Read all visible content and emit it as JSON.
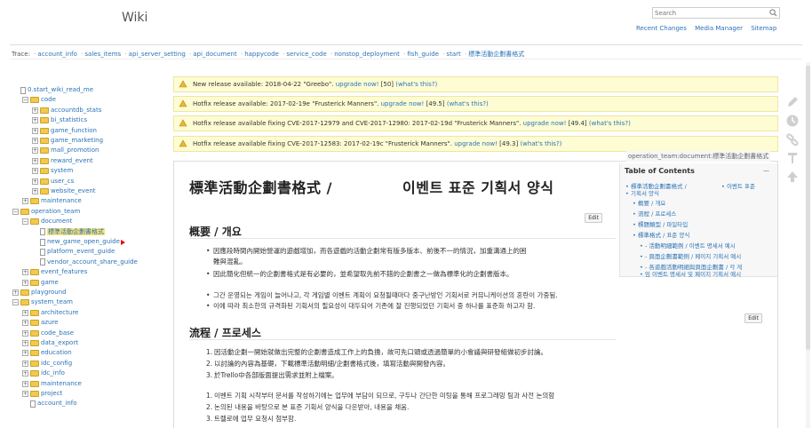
{
  "header": {
    "site_title": "Wiki",
    "search_placeholder": "Search",
    "links": [
      "Recent Changes",
      "Media Manager",
      "Sitemap"
    ]
  },
  "breadcrumbs": {
    "label": "Trace:",
    "items": [
      "account_info",
      "sales_items",
      "api_server_setting",
      "api_document",
      "happycode",
      "service_code",
      "nonstop_deployment",
      "fish_guide",
      "start"
    ],
    "current": "標準活動企劃書格式"
  },
  "sidebar": {
    "tree": [
      {
        "label": "0.start_wiki_read_me",
        "kind": "page",
        "toggle": "",
        "active": false
      },
      {
        "label": "code",
        "kind": "folder",
        "toggle": "-",
        "active": false
      },
      {
        "label": "accountdb_stats",
        "kind": "folder",
        "toggle": "+",
        "active": false
      },
      {
        "label": "bi_statistics",
        "kind": "folder",
        "toggle": "+",
        "active": false
      },
      {
        "label": "game_function",
        "kind": "folder",
        "toggle": "+",
        "active": false
      },
      {
        "label": "game_marketing",
        "kind": "folder",
        "toggle": "+",
        "active": false
      },
      {
        "label": "mall_promotion",
        "kind": "folder",
        "toggle": "+",
        "active": false
      },
      {
        "label": "reward_event",
        "kind": "folder",
        "toggle": "+",
        "active": false
      },
      {
        "label": "system",
        "kind": "folder",
        "toggle": "+",
        "active": false
      },
      {
        "label": "user_cs",
        "kind": "folder",
        "toggle": "+",
        "active": false
      },
      {
        "label": "website_event",
        "kind": "folder",
        "toggle": "+",
        "active": false
      },
      {
        "label": "maintenance",
        "kind": "folder",
        "toggle": "+",
        "active": false
      },
      {
        "label": "operation_team",
        "kind": "folder",
        "toggle": "-",
        "active": false
      },
      {
        "label": "document",
        "kind": "folder",
        "toggle": "-",
        "active": false
      },
      {
        "label": "標準活動企劃書格式",
        "kind": "page",
        "toggle": "",
        "active": true
      },
      {
        "label": "new_game_open_guide",
        "kind": "page",
        "toggle": "",
        "active": false
      },
      {
        "label": "platform_event_guide",
        "kind": "page",
        "toggle": "",
        "active": false
      },
      {
        "label": "vendor_account_share_guide",
        "kind": "page",
        "toggle": "",
        "active": false
      },
      {
        "label": "event_features",
        "kind": "folder",
        "toggle": "+",
        "active": false
      },
      {
        "label": "game",
        "kind": "folder",
        "toggle": "+",
        "active": false
      },
      {
        "label": "playground",
        "kind": "folder",
        "toggle": "+",
        "active": false
      },
      {
        "label": "system_team",
        "kind": "folder",
        "toggle": "-",
        "active": false
      },
      {
        "label": "architecture",
        "kind": "folder",
        "toggle": "+",
        "active": false
      },
      {
        "label": "azure",
        "kind": "folder",
        "toggle": "+",
        "active": false
      },
      {
        "label": "code_base",
        "kind": "folder",
        "toggle": "+",
        "active": false
      },
      {
        "label": "data_export",
        "kind": "folder",
        "toggle": "+",
        "active": false
      },
      {
        "label": "education",
        "kind": "folder",
        "toggle": "+",
        "active": false
      },
      {
        "label": "idc_config",
        "kind": "folder",
        "toggle": "+",
        "active": false
      },
      {
        "label": "idc_info",
        "kind": "folder",
        "toggle": "+",
        "active": false
      },
      {
        "label": "maintenance",
        "kind": "folder",
        "toggle": "+",
        "active": false
      },
      {
        "label": "project",
        "kind": "folder",
        "toggle": "+",
        "active": false
      },
      {
        "label": "account_info",
        "kind": "page",
        "toggle": "",
        "active": false
      }
    ]
  },
  "notices": [
    {
      "text": "New release available: 2018-04-22 \"Greebo\". ",
      "link": "upgrade now!",
      "tail": " [50] ",
      "what": "(what's this?)"
    },
    {
      "text": "Hotfix release available: 2017-02-19e \"Frusterick Manners\". ",
      "link": "upgrade now!",
      "tail": " [49.5] ",
      "what": "(what's this?)"
    },
    {
      "text": "Hotfix release available fixing CVE-2017-12979 and CVE-2017-12980: 2017-02-19d \"Frusterick Manners\". ",
      "link": "upgrade now!",
      "tail": " [49.4] ",
      "what": "(what's this?)"
    },
    {
      "text": "Hotfix release available fixing CVE-2017-12583: 2017-02-19c \"Frusterick Manners\". ",
      "link": "upgrade now!",
      "tail": " [49.3] ",
      "what": "(what's this?)"
    }
  ],
  "page": {
    "id": "operation_team:document:標準活動企劃書格式",
    "title_cn": "標準活動企劃書格式 /",
    "title_ko": "이벤트 표준 기획서 양식",
    "edit_label": "Edit",
    "section1": {
      "heading": "概要 / 개요",
      "bullets_a": [
        "因應段時間內開始營運的遊戲增加，而各遊戲的活動企劃常有版多版本、前後不一的情況，加重溝通上的困",
        "難與混亂。",
        "因此簡化但統一的企劃書格式是有必要的，並希望取先前不錯的企劃書之一做為標準化的企劃書版本。"
      ],
      "bullets_b": [
        "그간 운영되는 게임이 늘어나고, 각 게임별 이벤트 계획이 요청될때마다 중구난방인 기획서로 커뮤니케이션의 혼란이 가중됨.",
        "이에 따라 최소한의 규격화된 기획서의 필요성이 대두되어 기존에 잘 진행되었던 기획서 중 하나를 표준화 하고자 함."
      ]
    },
    "section2": {
      "heading": "流程 / 프로세스",
      "steps_a": [
        "因活動企劃一開始就做出完整的企劃書造成工作上的負擔，故可先口頭或透過簡單的小會議與研發組做初步討論。",
        "以討論的內容為基礎，下載標準活動明細/企劃書格式後，填寫活動與開發內容。",
        "於Trello中各部版面提出需求並附上檔案。"
      ],
      "steps_b": [
        "이벤트 기획 시작부터 문서를 작성하기에는 업무에 부담이 되므로, 구두나 간단한 미팅을 통해 프로그래밍 팀과 사전 논의함",
        "논의된 내용을 바탕으로 본 표준 기획서 양식을 다운받아, 내용을 채움.",
        "트렐로에 업무 요청시 첨부함."
      ]
    }
  },
  "toc": {
    "title": "Table of Contents",
    "toggle": "—",
    "items": [
      "標準活動企劃書格式 /",
      "이벤트 표준",
      "기획서 양식",
      "概要 / 개요",
      "流程 / 프로세스",
      "標題類型 / 파일타입",
      "標準格式 / 표준 양식",
      "- 活動明細範例 / 이벤트 명세서 예시",
      "- 頁面企劃書範例 / 페이지 기획서 예시",
      "- 各遊戲活動明細與頁面企劃書 / 각 게",
      "임 이벤트 명세서 및 페이지 기획서 예시"
    ]
  },
  "colors": {
    "link": "#2b73b7",
    "notice_bg": "#fefcd3",
    "active_highlight": "#f6e27a"
  }
}
